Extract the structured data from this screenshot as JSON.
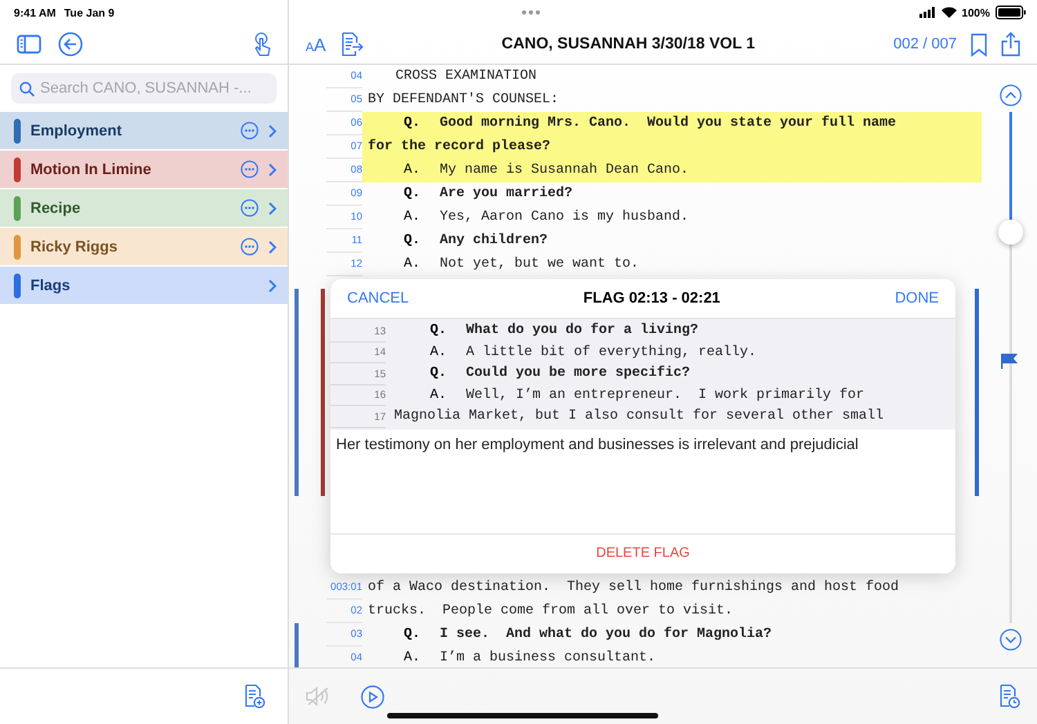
{
  "status_bar": {
    "time": "9:41 AM",
    "date": "Tue Jan 9",
    "battery": "100%"
  },
  "sidebar": {
    "search": {
      "placeholder": "Search CANO, SUSANNAH -..."
    },
    "items": [
      {
        "name": "Employment",
        "color": "#2f6db5",
        "more_button": true
      },
      {
        "name": "Motion In Limine",
        "color": "#c23b33",
        "more_button": true
      },
      {
        "name": "Recipe",
        "color": "#5aa356",
        "more_button": true
      },
      {
        "name": "Ricky Riggs",
        "color": "#e0963f",
        "more_button": true
      },
      {
        "name": "Flags",
        "color": "#2f6ee0",
        "more_button": false
      }
    ]
  },
  "toolbar": {
    "text_size": "AA",
    "title": "CANO, SUSANNAH 3/30/18 VOL 1",
    "page_counter": "002 / 007"
  },
  "transcript": {
    "lines_above": [
      {
        "num": "04",
        "kind": "heading",
        "text": "CROSS EXAMINATION",
        "bold": false,
        "highlighted": false,
        "flagged": false
      },
      {
        "num": "05",
        "kind": "plain",
        "text": "BY DEFENDANT'S COUNSEL:",
        "bold": false,
        "highlighted": false,
        "flagged": false
      },
      {
        "num": "06",
        "kind": "qa",
        "speaker": "Q.",
        "text": "Good morning Mrs. Cano.  Would you state your full name",
        "bold": true,
        "highlighted": true,
        "flagged": false
      },
      {
        "num": "07",
        "kind": "plain",
        "text": "for the record please?",
        "bold": true,
        "highlighted": true,
        "flagged": false
      },
      {
        "num": "08",
        "kind": "qa",
        "speaker": "A.",
        "text": "My name is Susannah Dean Cano.",
        "bold": false,
        "highlighted": true,
        "flagged": false
      },
      {
        "num": "09",
        "kind": "qa",
        "speaker": "Q.",
        "text": "Are you married?",
        "bold": true,
        "highlighted": false,
        "flagged": false
      },
      {
        "num": "10",
        "kind": "qa",
        "speaker": "A.",
        "text": "Yes, Aaron Cano is my husband.",
        "bold": false,
        "highlighted": false,
        "flagged": false
      },
      {
        "num": "11",
        "kind": "qa",
        "speaker": "Q.",
        "text": "Any children?",
        "bold": true,
        "highlighted": false,
        "flagged": false
      },
      {
        "num": "12",
        "kind": "qa",
        "speaker": "A.",
        "text": "Not yet, but we want to.",
        "bold": false,
        "highlighted": false,
        "flagged": false
      }
    ],
    "lines_below": [
      {
        "num": "003:01",
        "kind": "plain",
        "text": "of a Waco destination.  They sell home furnishings and host food",
        "bold": false,
        "highlighted": false,
        "flagged": false
      },
      {
        "num": "02",
        "kind": "plain",
        "text": "trucks.  People come from all over to visit.",
        "bold": false,
        "highlighted": false,
        "flagged": false
      },
      {
        "num": "03",
        "kind": "qa",
        "speaker": "Q.",
        "text": "I see.  And what do you do for Magnolia?",
        "bold": true,
        "highlighted": false,
        "flagged": true
      },
      {
        "num": "04",
        "kind": "qa",
        "speaker": "A.",
        "text": "I’m a business consultant.",
        "bold": false,
        "highlighted": false,
        "flagged": true
      }
    ]
  },
  "flag_popover": {
    "cancel": "CANCEL",
    "title": "FLAG 02:13 - 02:21",
    "done": "DONE",
    "left_markers": [
      {
        "color": "#4a78c2"
      },
      {
        "color": "#a33b36"
      }
    ],
    "right_markers": [
      {
        "color": "#2f6ad0"
      }
    ],
    "excerpt": [
      {
        "num": "13",
        "kind": "qa",
        "speaker": "Q.",
        "text": "What do you do for a living?",
        "bold": true
      },
      {
        "num": "14",
        "kind": "qa",
        "speaker": "A.",
        "text": "A little bit of everything, really.",
        "bold": false
      },
      {
        "num": "15",
        "kind": "qa",
        "speaker": "Q.",
        "text": "Could you be more specific?",
        "bold": true
      },
      {
        "num": "16",
        "kind": "qa",
        "speaker": "A.",
        "text": "Well, I’m an entrepreneur.  I work primarily for",
        "bold": false
      },
      {
        "num": "17",
        "kind": "plain",
        "text": "Magnolia Market, but I also consult for several other small",
        "bold": false
      }
    ],
    "note": "Her testimony on her employment and businesses is irrelevant and prejudicial",
    "delete": "DELETE FLAG"
  },
  "bottom_bar": {
    "speaker_disabled": true
  }
}
